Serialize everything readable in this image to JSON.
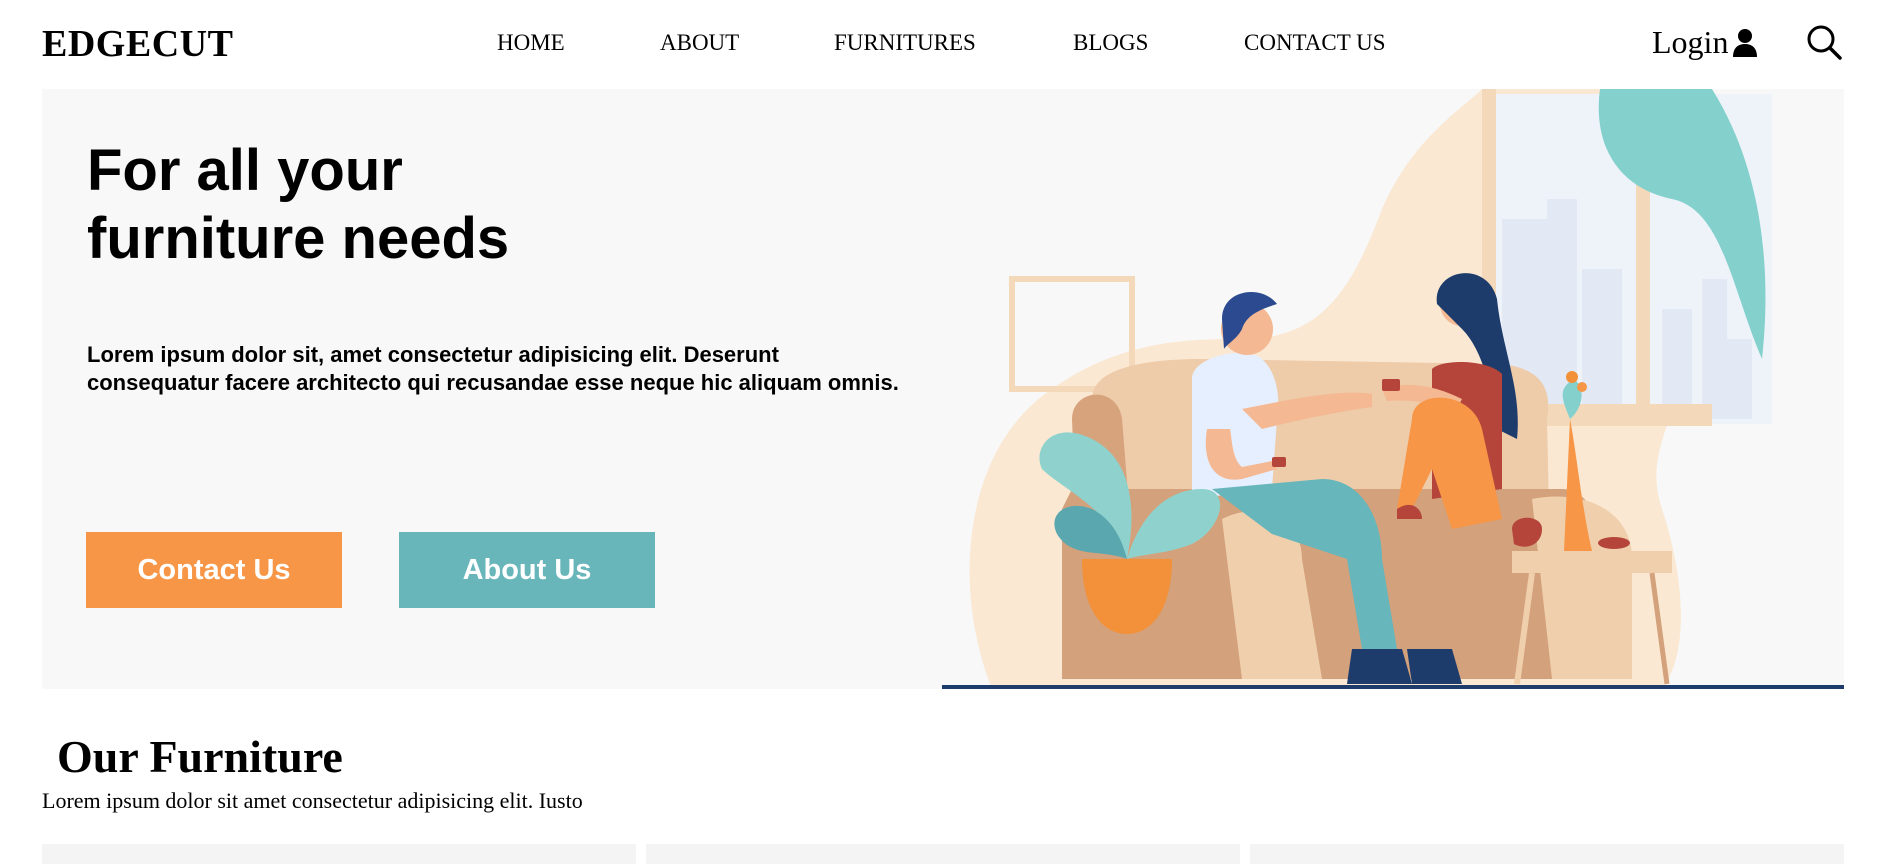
{
  "brand": {
    "logo": "EDGECUT"
  },
  "nav": {
    "items": [
      "HOME",
      "ABOUT",
      "FURNITURES",
      "BLOGS",
      "CONTACT US"
    ],
    "login_label": "Login"
  },
  "hero": {
    "title": "For all your furniture needs",
    "description": "Lorem ipsum dolor sit, amet consectetur adipisicing elit. Deserunt consequatur facere architecto qui recusandae esse neque hic aliquam omnis.",
    "contact_button": "Contact Us",
    "about_button": "About Us",
    "illustration": "couple-on-sofa-illustration"
  },
  "section": {
    "title": "Our Furniture",
    "subtitle": "Lorem ipsum dolor sit amet consectetur adipisicing elit. Iusto"
  },
  "colors": {
    "accent_orange": "#f79646",
    "accent_teal": "#68b5ba",
    "hero_background": "#f7f8f7"
  }
}
